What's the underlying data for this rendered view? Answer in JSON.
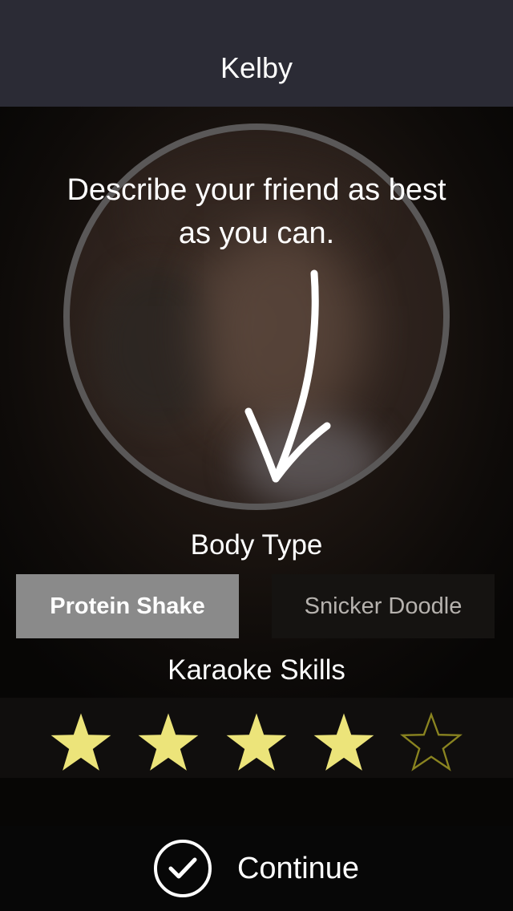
{
  "nav": {
    "title": "Kelby"
  },
  "instruction": "Describe your friend as best\nas you can.",
  "body_type": {
    "label": "Body Type",
    "options": [
      {
        "label": "Protein Shake",
        "selected": true
      },
      {
        "label": "Snicker Doodle",
        "selected": false
      }
    ]
  },
  "karaoke": {
    "label": "Karaoke Skills",
    "rating": 4,
    "max": 5
  },
  "continue": {
    "label": "Continue",
    "icon": "check-icon"
  },
  "colors": {
    "star_filled": "#ece47a",
    "star_empty_outline": "#8a8420",
    "nav_bg": "#2b2b35",
    "selected_bg": "#8a8a8a",
    "unselected_bg": "#151311"
  }
}
